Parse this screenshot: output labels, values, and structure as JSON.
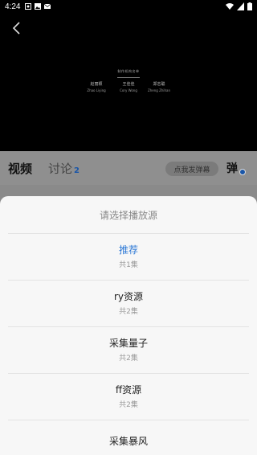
{
  "status_bar": {
    "time": "4:24"
  },
  "video": {
    "credits_title": "制作机构名单",
    "credits": [
      {
        "cn": "赵丽颖",
        "en": "Zhao Liying"
      },
      {
        "cn": "王佳佳",
        "en": "Cory Wong"
      },
      {
        "cn": "郑志聪",
        "en": "Zheng Zhihan"
      }
    ]
  },
  "tabs": {
    "video_label": "视频",
    "discuss_label": "讨论",
    "discuss_count": "2",
    "danmu_placeholder": "点我发弹幕",
    "danmu_button": "弹"
  },
  "sheet": {
    "title": "请选择播放源",
    "sources": [
      {
        "name": "推荐",
        "count": "共1集",
        "active": true
      },
      {
        "name": "ry资源",
        "count": "共2集",
        "active": false
      },
      {
        "name": "采集量子",
        "count": "共2集",
        "active": false
      },
      {
        "name": "ff资源",
        "count": "共2集",
        "active": false
      },
      {
        "name": "采集暴风",
        "count": "",
        "active": false
      }
    ]
  },
  "colors": {
    "accent": "#2e79d6",
    "count_blue": "#1a56a8"
  }
}
